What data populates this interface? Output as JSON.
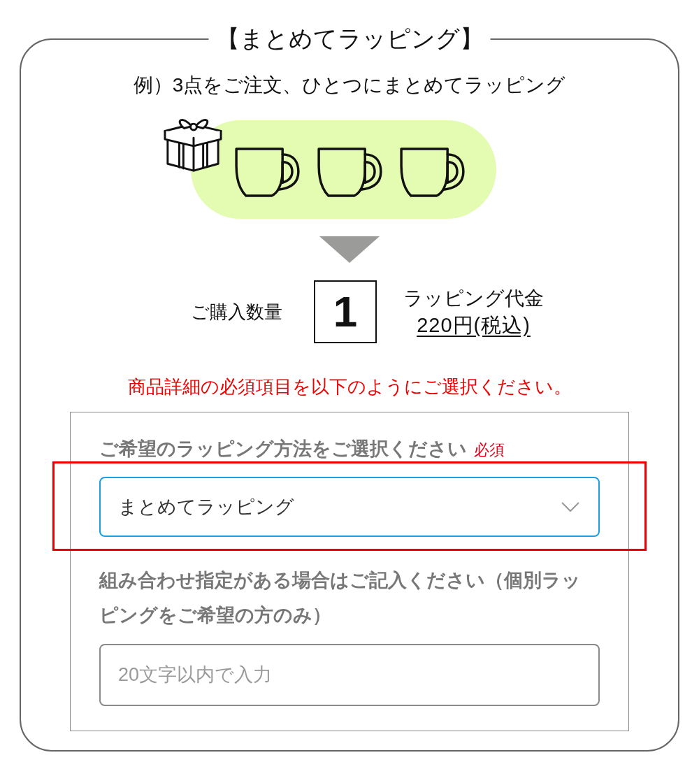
{
  "section": {
    "title": "【まとめてラッピング】",
    "example": "例）3点をご注文、ひとつにまとめてラッピング"
  },
  "quantity": {
    "label": "ご購入数量",
    "value": "1"
  },
  "fee": {
    "label": "ラッピング代金",
    "amount": "220円(税込)"
  },
  "notice": "商品詳細の必須項目を以下のようにご選択ください。",
  "form": {
    "fields": [
      {
        "kind": "select",
        "label": "ご希望のラッピング方法をご選択ください",
        "required_badge": "必須",
        "value": "まとめてラッピング",
        "highlighted": true
      },
      {
        "kind": "text",
        "label": "組み合わせ指定がある場合はご記入ください（個別ラッピングをご希望の方のみ）",
        "placeholder": "20文字以内で入力",
        "highlighted": false
      }
    ]
  }
}
